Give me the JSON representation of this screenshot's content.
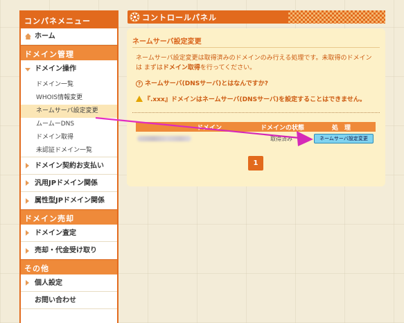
{
  "sidebar": {
    "header": "コンパネメニュー",
    "home": "ホーム",
    "sec_domain_manage": "ドメイン管理",
    "domain_ops": "ドメイン操作",
    "sub_items": [
      "ドメイン一覧",
      "WHOIS情報変更",
      "ネームサーバ設定変更",
      "ムームーDNS",
      "ドメイン取得",
      "未認証ドメイン一覧"
    ],
    "contract_pay": "ドメイン契約お支払い",
    "jp_general": "汎用JPドメイン関係",
    "jp_attr": "属性型JPドメイン関係",
    "sec_domain_sale": "ドメイン売却",
    "domain_appraise": "ドメイン査定",
    "sale_receive": "売却・代金受け取り",
    "sec_other": "その他",
    "personal": "個人設定",
    "contact": "お問い合わせ"
  },
  "panel": {
    "title": "コントロールパネル",
    "card_title": "ネームサーバ設定変更",
    "desc_1": "ネームサーバ設定変更は取得済みのドメインのみ行える処理です。未取得のドメイン",
    "desc_2_pre": "は まずは",
    "desc_2_link": "ドメイン取得",
    "desc_2_post": "を行ってください。",
    "help": "ネームサーバ(DNSサーバ)とはなんですか?",
    "help_mark": "?",
    "warn": "『.xxx』ドメインはネームサーバ(DNSサーバ)を設定することはできません。"
  },
  "table": {
    "col_domain": "ドメイン",
    "col_status": "ドメインの状態",
    "col_process": "処　理",
    "row_status": "取得済み",
    "row_button": "ネームサーバ設定変更"
  },
  "pagination": {
    "current": "1"
  },
  "colors": {
    "accent": "#e26a1d",
    "section": "#ef8a3a",
    "card": "#fdf1c8",
    "arrow": "#e62ec4",
    "button": "#7fd3f0"
  }
}
